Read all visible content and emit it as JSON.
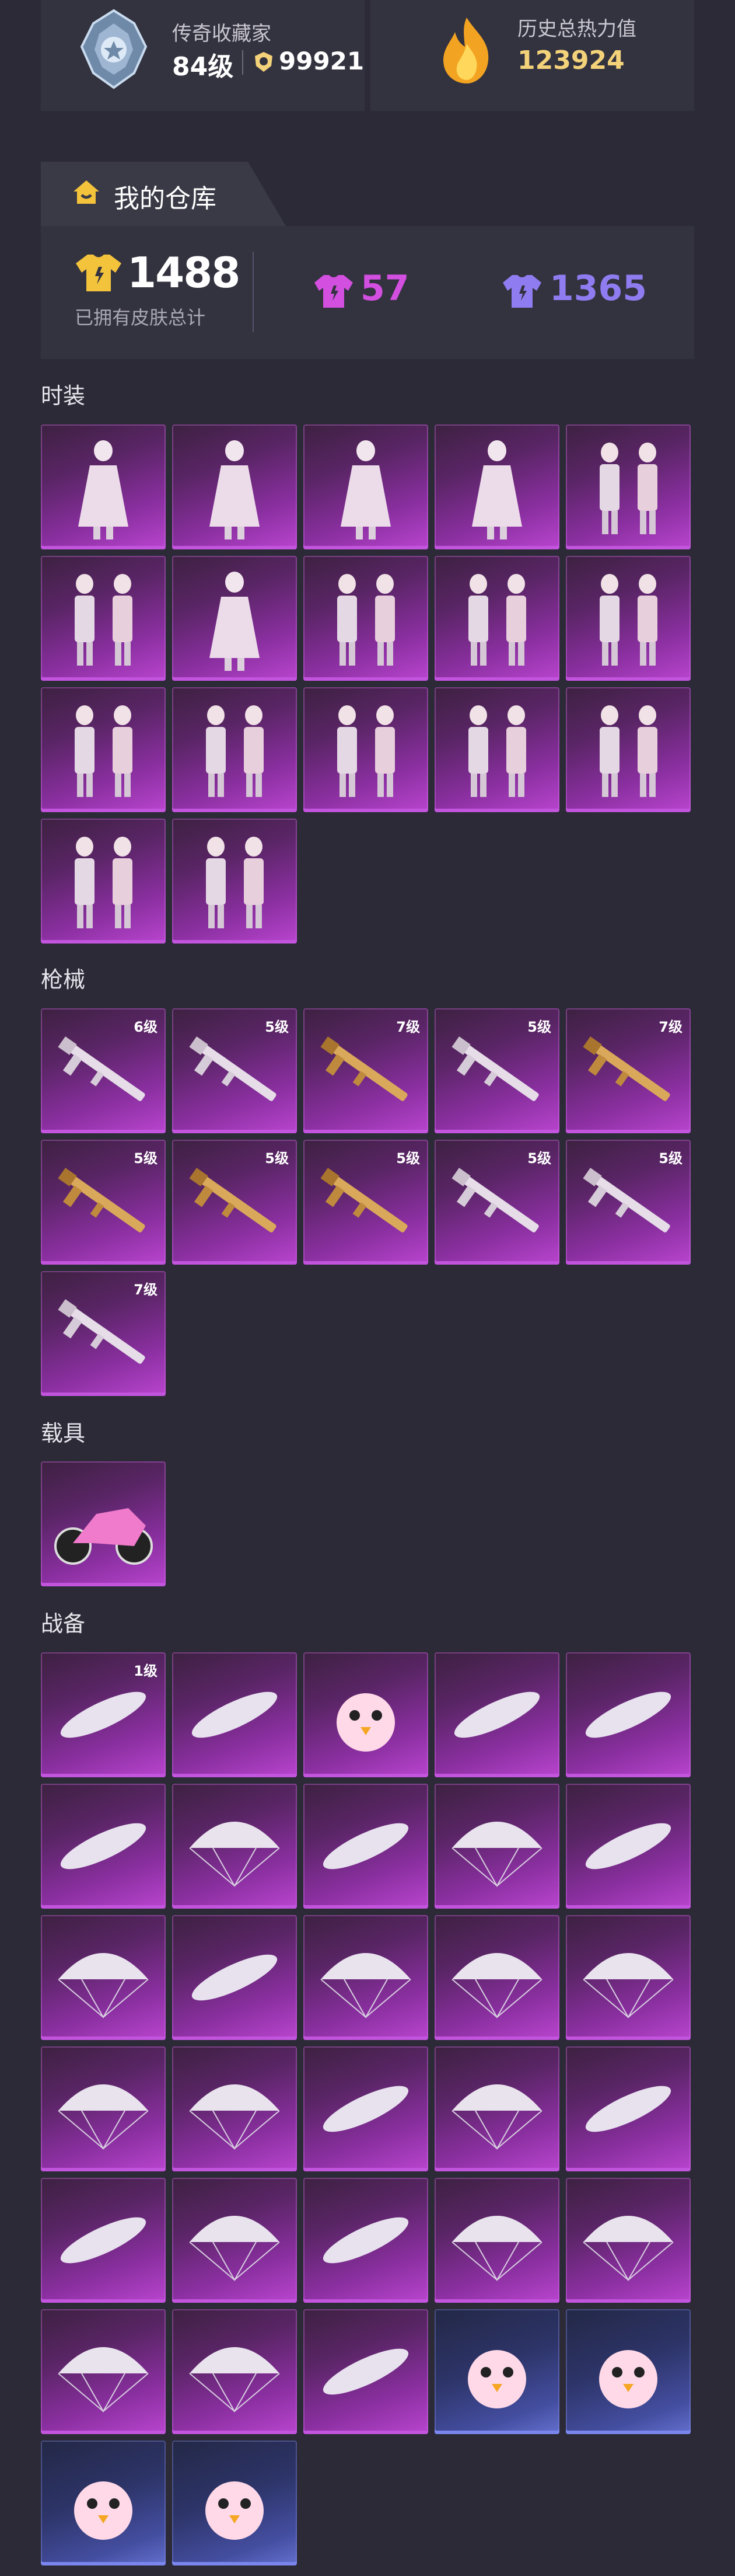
{
  "header": {
    "collector_title": "传奇收藏家",
    "level": "84级",
    "coins": "99921",
    "heat_label": "历史总热力值",
    "heat_value": "123924"
  },
  "warehouse": {
    "tab_label": "我的仓库",
    "total_count": "1488",
    "total_label": "已拥有皮肤总计",
    "pink_count": "57",
    "purple_count": "1365"
  },
  "sections": {
    "fashion": "时装",
    "guns": "枪械",
    "vehicles": "载具",
    "gear": "战备"
  },
  "guns": {
    "levels": [
      "6级",
      "5级",
      "7级",
      "5级",
      "7级",
      "5级",
      "5级",
      "5级",
      "5级",
      "5级",
      "7级"
    ]
  },
  "gear": {
    "first_level": "1级"
  },
  "colors": {
    "background": "#2b2a36",
    "card": "#33323f",
    "gold": "#f3d27a",
    "pink_accent": "#d24fe0",
    "purple_accent": "#8f7cf0"
  }
}
